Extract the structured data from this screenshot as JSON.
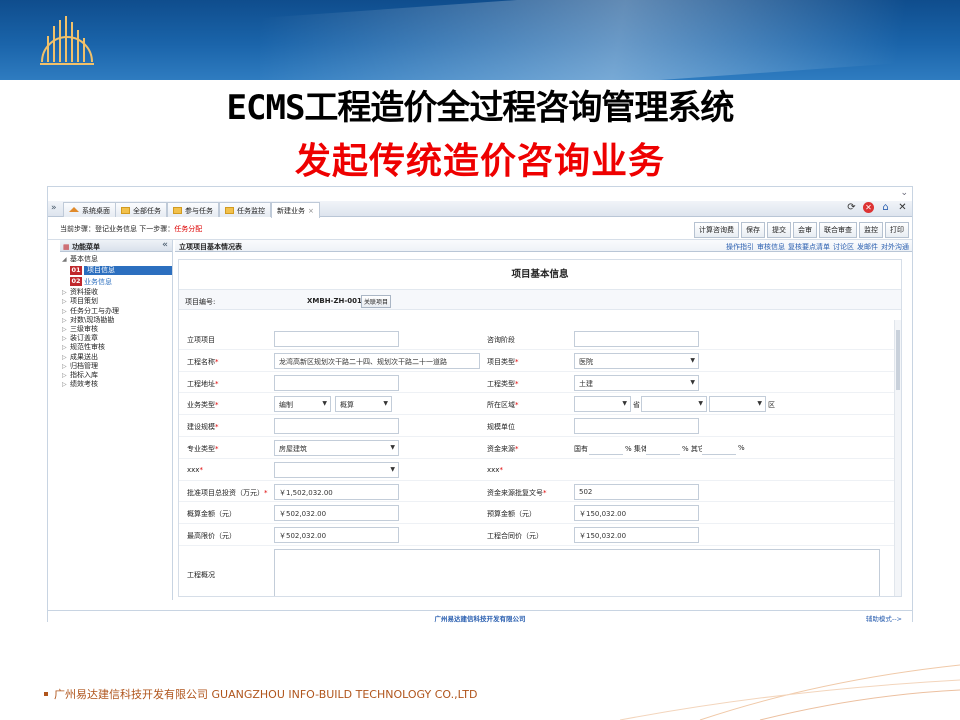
{
  "slide": {
    "title_line1": "ECMS工程造价全过程咨询管理系统",
    "title_line2": "发起传统造价咨询业务",
    "company_footer": "广州易达建信科技开发有限公司  GUANGZHOU INFO-BUILD TECHNOLOGY CO.,LTD",
    "accent": "#e00000",
    "brand": "#1a64aa"
  },
  "app": {
    "tabs": [
      {
        "label": "系统桌面",
        "icon": "house-icon"
      },
      {
        "label": "全部任务",
        "icon": "folder-icon"
      },
      {
        "label": "参与任务",
        "icon": "folder-icon"
      },
      {
        "label": "任务监控",
        "icon": "folder-icon"
      },
      {
        "label": "新建业务",
        "icon": "",
        "close": "×"
      }
    ],
    "breadcrumb": {
      "prefix": "当前步骤：登记业务信息 下一步骤：",
      "next": "任务分配"
    },
    "toolbar": [
      "计算咨询费",
      "保存",
      "提交",
      "会审",
      "联合审查",
      "监控",
      "打印"
    ],
    "sidebar": {
      "title": "功能菜单",
      "collapse": "«",
      "root": "基本信息",
      "subs": [
        {
          "num": "01",
          "label": "项目信息"
        },
        {
          "num": "02",
          "label": "业务信息"
        }
      ],
      "items": [
        "资料接收",
        "项目策划",
        "任务分工与办理",
        "对数\\现场勘勘",
        "三级审核",
        "装订盖章",
        "规范性审核",
        "成果送出",
        "归档管理",
        "指标入库",
        "绩效考核"
      ]
    },
    "panel": {
      "title": "立项项目基本情况表",
      "links": [
        "操作指引",
        "审核信息",
        "复核要点清单",
        "讨论区",
        "发邮件",
        "对外沟通"
      ]
    },
    "form": {
      "heading": "项目基本信息",
      "project_no_label": "项目编号:",
      "project_no": "XMBH-ZH-001",
      "project_no_btn": "关联项目",
      "rows": [
        {
          "l1": "立项项目",
          "v1": "",
          "l2": "咨询阶段",
          "v2": ""
        },
        {
          "l1": "工程名称",
          "v1": "龙湾高新区规划次干路二十四、规划次干路二十一道路",
          "l2": "项目类型",
          "v2": "医院"
        },
        {
          "l1": "工程地址",
          "v1": "",
          "l2": "工程类型",
          "v2": "土建"
        },
        {
          "l1": "业务类型",
          "v1a": "编制",
          "v1b": "概算",
          "l2": "所在区域",
          "r_sheng": "省",
          "r_shi": "市",
          "r_qu": "区"
        },
        {
          "l1": "建设规模",
          "v1": "",
          "l2": "规模单位",
          "v2": ""
        },
        {
          "l1": "专业类型",
          "v1": "房屋建筑",
          "l2": "资金来源",
          "f1": "国有",
          "f2": "% 集体",
          "f3": "% 其它",
          "f4": "%"
        },
        {
          "l1": "xxx",
          "v1": "",
          "l2": "xxx",
          "v2": ""
        },
        {
          "l1": "批准项目总投资（万元）",
          "v1": "￥1,502,032.00",
          "l2": "资金来源批复文号",
          "v2": "502"
        },
        {
          "l1": "概算金额（元）",
          "v1": "￥502,032.00",
          "l2": "预算金额（元）",
          "v2": "￥150,032.00"
        },
        {
          "l1": "最高限价（元）",
          "v1": "￥502,032.00",
          "l2": "工程合同价（元）",
          "v2": "￥150,032.00"
        }
      ],
      "overview_label": "工程概况"
    },
    "footer": {
      "center": "广州易达建信科技开发有限公司",
      "right": "辅助模式-->"
    }
  }
}
